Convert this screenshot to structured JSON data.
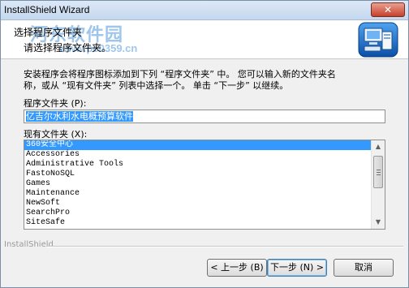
{
  "window": {
    "title": "InstallShield Wizard",
    "close_label": "✕"
  },
  "header": {
    "title": "选择程序文件夹",
    "subtitle": "请选择程序文件夹。",
    "watermark_text": "河东软件园",
    "watermark_url": "www.pc0359.cn",
    "logo_icon": "installer-computer-icon"
  },
  "body": {
    "description_line1": "安装程序会将程序图标添加到下列 “程序文件夹” 中。 您可以输入新的文件夹名",
    "description_line2": "称，或从 “现有文件夹” 列表中选择一个。 单击 “下一步” 以继续。",
    "folder_label": "程序文件夹 (P):",
    "folder_value": "亿吉尔水利水电概预算软件",
    "existing_label": "现有文件夹 (X):",
    "existing_folders": [
      "360安全中心",
      "Accessories",
      "Administrative Tools",
      "FastoNoSQL",
      "Games",
      "Maintenance",
      "NewSoft",
      "SearchPro",
      "SiteSafe"
    ]
  },
  "footer": {
    "brand": "InstallShield",
    "back_label": "< 上一步 (B)",
    "next_label": "下一步 (N) >",
    "cancel_label": "取消"
  },
  "colors": {
    "selection": "#3399ff",
    "watermark": "#2980d2",
    "close_button": "#c7402c"
  }
}
